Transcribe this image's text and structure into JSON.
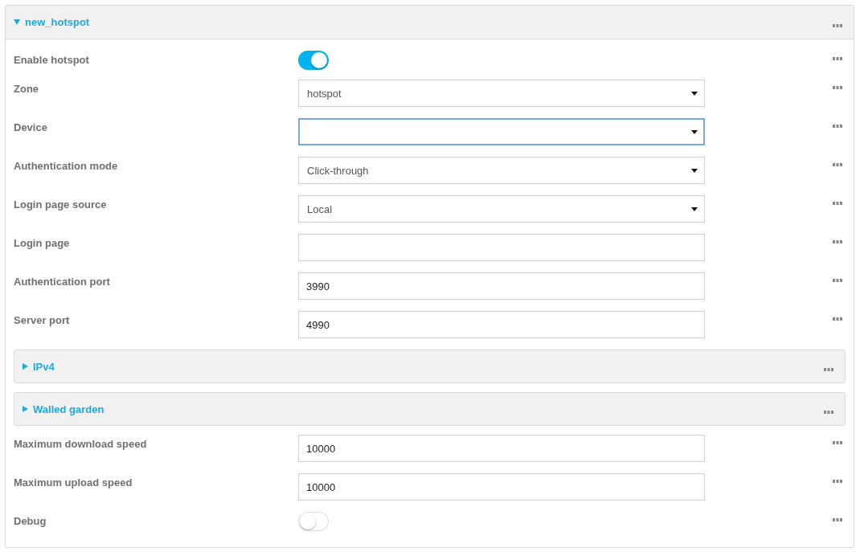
{
  "panel": {
    "title": "new_hotspot",
    "expanded": true,
    "rows": [
      {
        "kind": "toggle",
        "label": "Enable hotspot",
        "on": true
      },
      {
        "kind": "select",
        "label": "Zone",
        "value": "hotspot",
        "focused": false
      },
      {
        "kind": "select",
        "label": "Device",
        "focused": true
      },
      {
        "kind": "select",
        "label": "Authentication mode",
        "value": "Click-through",
        "focused": false
      },
      {
        "kind": "select",
        "label": "Login page source",
        "value": "Local",
        "focused": false
      },
      {
        "kind": "text",
        "label": "Login page"
      },
      {
        "kind": "text",
        "label": "Authentication port",
        "value": "3990"
      },
      {
        "kind": "text",
        "label": "Server port",
        "value": "4990"
      },
      {
        "kind": "section",
        "label": "IPv4",
        "expanded": false
      },
      {
        "kind": "section",
        "label": "Walled garden",
        "expanded": false
      },
      {
        "kind": "text",
        "label": "Maximum download speed",
        "value": "10000"
      },
      {
        "kind": "text",
        "label": "Maximum upload speed",
        "value": "10000"
      },
      {
        "kind": "toggle",
        "label": "Debug",
        "on": false
      }
    ]
  }
}
